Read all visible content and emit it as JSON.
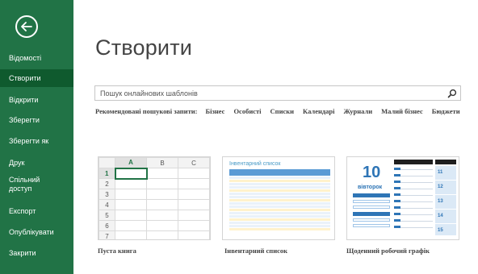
{
  "sidebar": {
    "items": [
      {
        "label": "Відомості"
      },
      {
        "label": "Створити",
        "active": true
      },
      {
        "label": "Відкрити"
      },
      {
        "label": "Зберегти"
      },
      {
        "label": "Зберегти як"
      },
      {
        "label": "Друк"
      },
      {
        "label": "Спільний доступ"
      },
      {
        "label": "Експорт"
      },
      {
        "label": "Опублікувати"
      },
      {
        "label": "Закрити"
      }
    ],
    "background_color": "#217346",
    "active_color": "#0f5a2e"
  },
  "main": {
    "title": "Створити",
    "search": {
      "placeholder": "Пошук онлайнових шаблонів"
    },
    "suggestions": {
      "label": "Рекомендовані пошукові запити:",
      "keywords": [
        "Бізнес",
        "Особисті",
        "Списки",
        "Календарі",
        "Журнали",
        "Малий бізнес",
        "Бюджети"
      ]
    },
    "templates": [
      {
        "caption": "Пуста книга",
        "columns": [
          "A",
          "B",
          "C"
        ],
        "rows": [
          "1",
          "2",
          "3",
          "4",
          "5",
          "6",
          "7"
        ]
      },
      {
        "caption": "Інвентарний список",
        "preview_title": "Інвентарний список"
      },
      {
        "caption": "Щоденний робочий графік",
        "preview_day_number": "10",
        "preview_day_name": "вівторок",
        "preview_calendar_numbers": [
          "11",
          "12",
          "13",
          "14",
          "15"
        ]
      }
    ]
  }
}
